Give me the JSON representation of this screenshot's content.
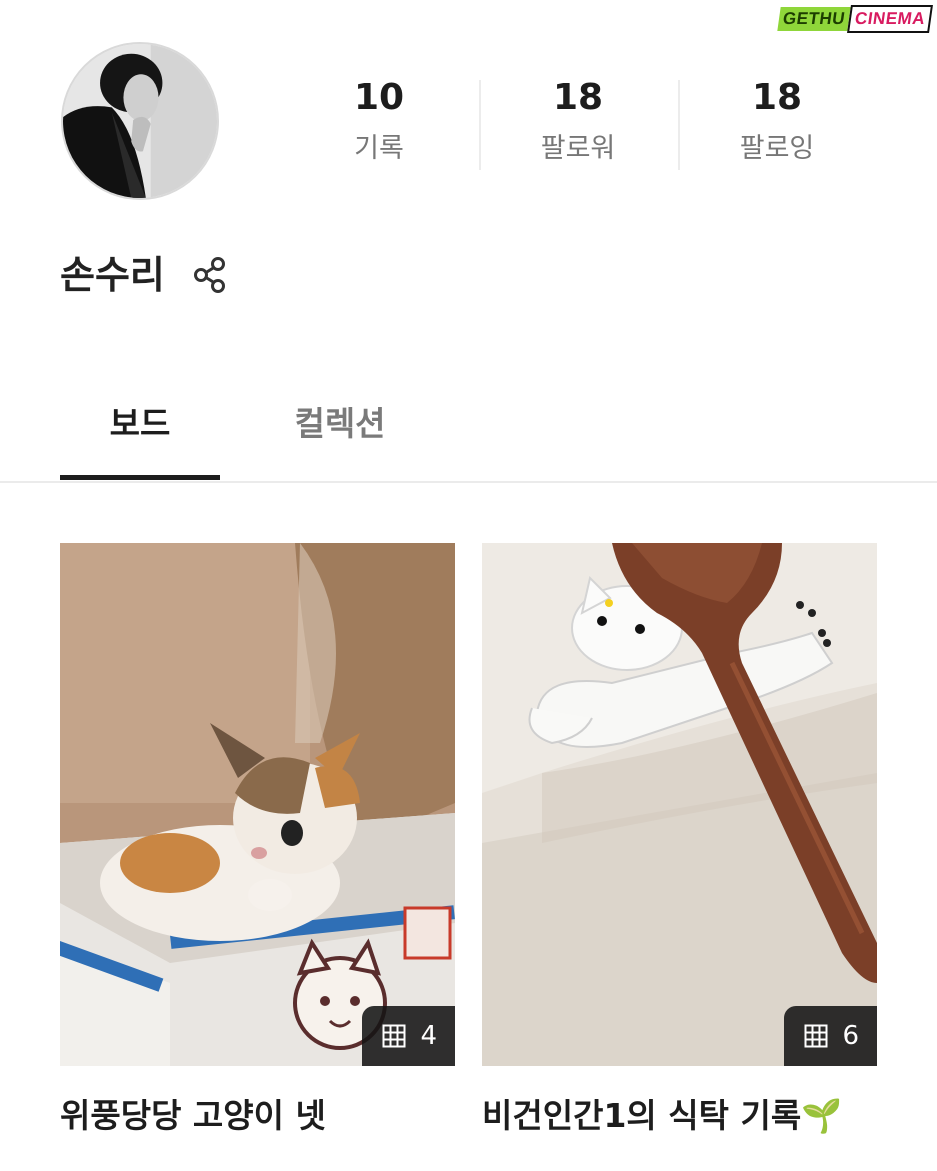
{
  "watermark": {
    "left": "GETHU",
    "right": "CINEMA"
  },
  "profile": {
    "name": "손수리",
    "stats": [
      {
        "value": "10",
        "label": "기록"
      },
      {
        "value": "18",
        "label": "팔로워"
      },
      {
        "value": "18",
        "label": "팔로잉"
      }
    ]
  },
  "tabs": [
    {
      "label": "보드",
      "active": true
    },
    {
      "label": "컬렉션",
      "active": false
    }
  ],
  "boards": [
    {
      "title": "위풍당당 고양이 넷",
      "count": "4",
      "photo_icon": "cat-in-box-photo"
    },
    {
      "title": "비건인간1의 식탁 기록",
      "count": "6",
      "photo_icon": "cat-spoon-rest-photo",
      "emoji": "🌱"
    }
  ],
  "colors": {
    "text": "#1d1d1d",
    "muted": "#777777",
    "badge_bg": "#141414"
  }
}
